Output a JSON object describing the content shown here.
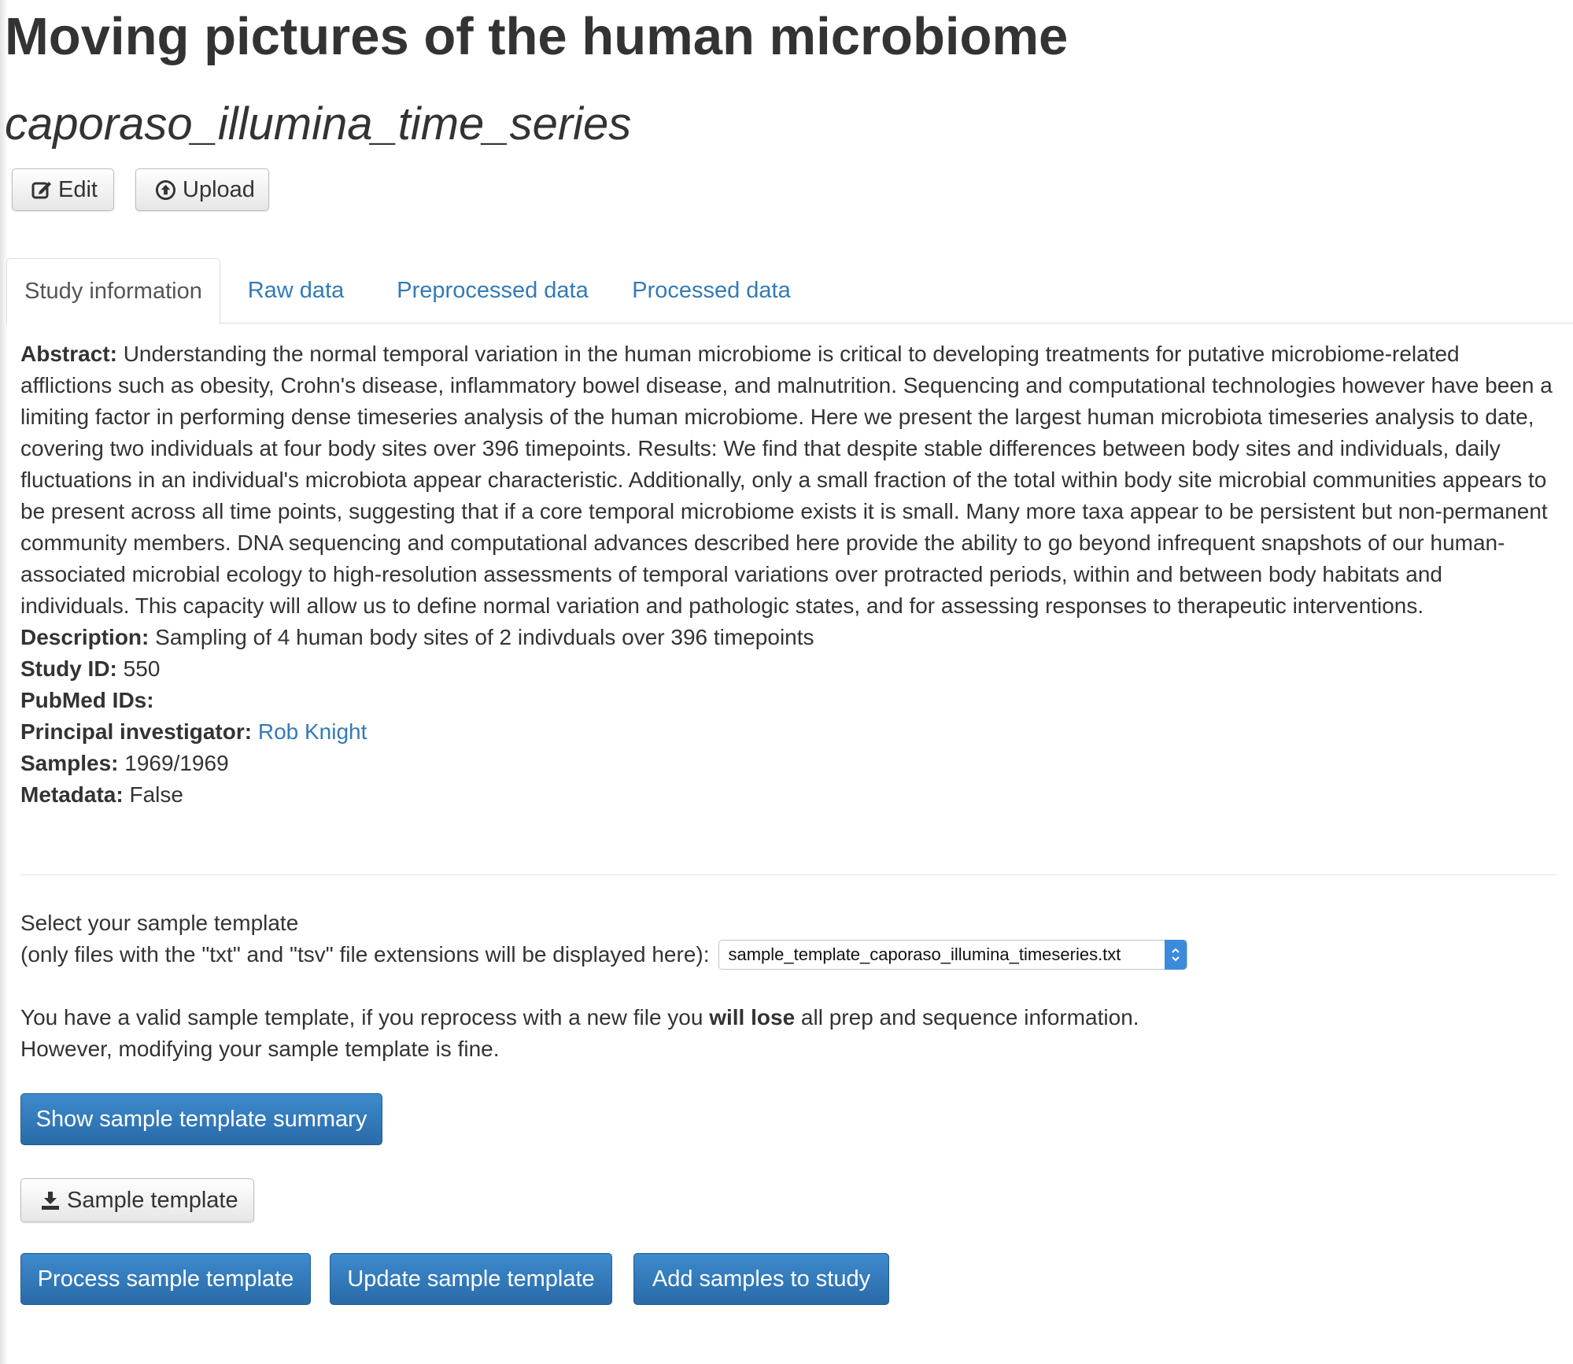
{
  "header": {
    "title": "Moving pictures of the human microbiome",
    "subtitle": "caporaso_illumina_time_series"
  },
  "toolbar": {
    "edit_label": "Edit",
    "upload_label": "Upload"
  },
  "tabs": [
    {
      "label": "Study information",
      "active": true
    },
    {
      "label": "Raw data",
      "active": false
    },
    {
      "label": "Preprocessed data",
      "active": false
    },
    {
      "label": "Processed data",
      "active": false
    }
  ],
  "study": {
    "abstract_label": "Abstract:",
    "abstract": "Understanding the normal temporal variation in the human microbiome is critical to developing treatments for putative microbiome-related afflictions such as obesity, Crohn's disease, inflammatory bowel disease, and malnutrition. Sequencing and computational technologies however have been a limiting factor in performing dense timeseries analysis of the human microbiome. Here we present the largest human microbiota timeseries analysis to date, covering two individuals at four body sites over 396 timepoints. Results: We find that despite stable differences between body sites and individuals, daily fluctuations in an individual's microbiota appear characteristic. Additionally, only a small fraction of the total within body site microbial communities appears to be present across all time points, suggesting that if a core temporal microbiome exists it is small. Many more taxa appear to be persistent but non-permanent community members. DNA sequencing and computational advances described here provide the ability to go beyond infrequent snapshots of our human-associated microbial ecology to high-resolution assessments of temporal variations over protracted periods, within and between body habitats and individuals. This capacity will allow us to define normal variation and pathologic states, and for assessing responses to therapeutic interventions.",
    "description_label": "Description:",
    "description": "Sampling of 4 human body sites of 2 indivduals over 396 timepoints",
    "study_id_label": "Study ID:",
    "study_id": "550",
    "pubmed_label": "PubMed IDs:",
    "pubmed": "",
    "pi_label": "Principal investigator:",
    "pi": "Rob Knight",
    "samples_label": "Samples:",
    "samples": "1969/1969",
    "metadata_label": "Metadata:",
    "metadata": "False"
  },
  "sample_template": {
    "select_heading": "Select your sample template",
    "select_note": "(only files with the \"txt\" and \"tsv\" file extensions will be displayed here):",
    "selected_file": "sample_template_caporaso_illumina_timeseries.txt",
    "warning_pre": "You have a valid sample template, if you reprocess with a new file you ",
    "warning_bold": "will lose",
    "warning_post": " all prep and sequence information.",
    "warning_line2": "However, modifying your sample template is fine.",
    "show_summary_label": "Show sample template summary",
    "download_label": "Sample template",
    "process_label": "Process sample template",
    "update_label": "Update sample template",
    "add_samples_label": "Add samples to study"
  },
  "icons": {
    "edit": "edit-icon",
    "upload": "upload-icon",
    "download": "download-icon",
    "select": "select-arrows-icon"
  },
  "colors": {
    "link": "#337ab7",
    "primary_button": "#337ab7",
    "text": "#333333"
  }
}
